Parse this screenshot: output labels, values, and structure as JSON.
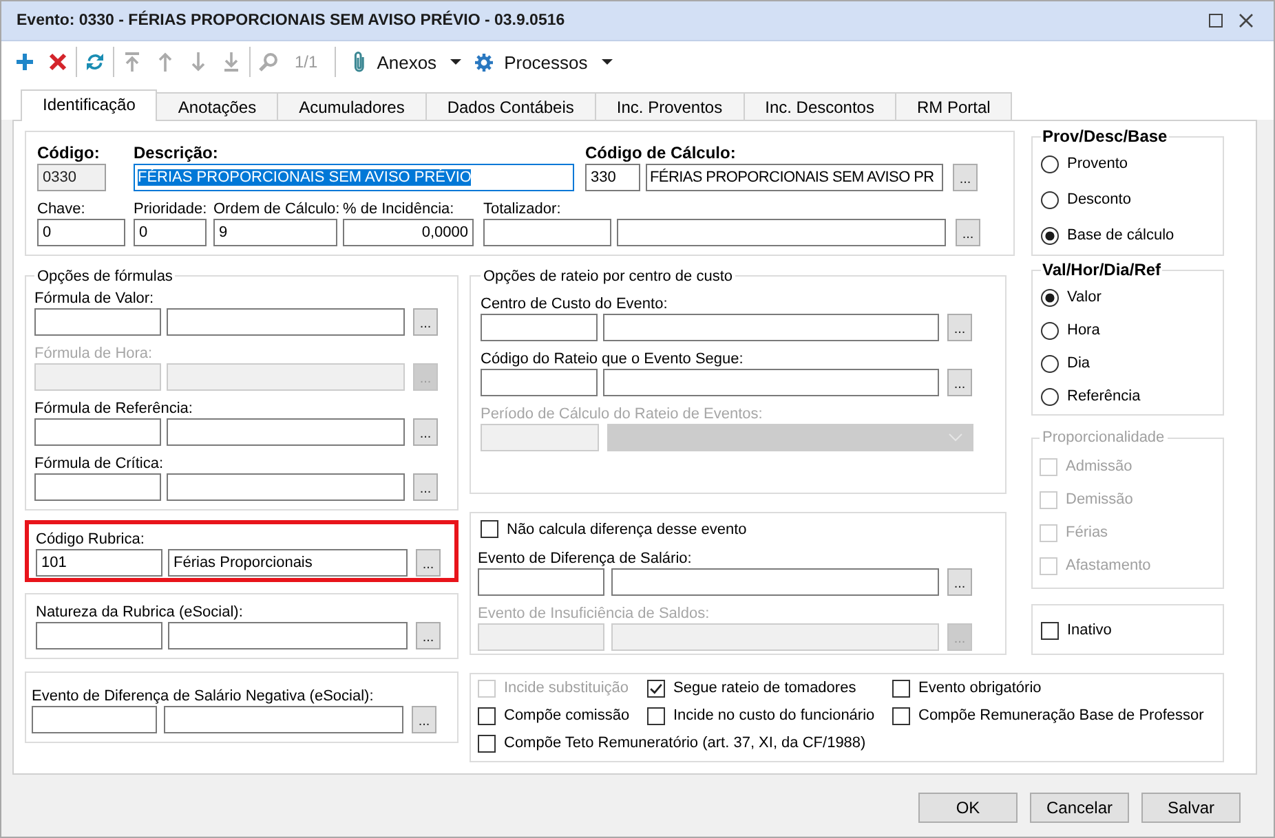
{
  "window": {
    "title": "Evento: 0330 - FÉRIAS PROPORCIONAIS SEM AVISO PRÉVIO - 03.9.0516"
  },
  "toolbar": {
    "button_groups": [
      [
        {
          "kind": "add",
          "disabled": false
        },
        {
          "kind": "delete",
          "disabled": false
        }
      ],
      [
        {
          "kind": "refresh",
          "disabled": false
        }
      ],
      [
        {
          "kind": "first",
          "disabled": true
        },
        {
          "kind": "previous",
          "disabled": true
        },
        {
          "kind": "next",
          "disabled": true
        },
        {
          "kind": "last",
          "disabled": true
        }
      ],
      [
        {
          "kind": "search",
          "disabled": true
        }
      ]
    ],
    "page_indicator": "1/1",
    "menus": [
      {
        "kind": "attachments",
        "label": "Anexos"
      },
      {
        "kind": "processes",
        "label": "Processos"
      }
    ]
  },
  "tabs": [
    {
      "label": "Identificação",
      "selected": true
    },
    {
      "label": "Anotações",
      "selected": false
    },
    {
      "label": "Acumuladores",
      "selected": false
    },
    {
      "label": "Dados Contábeis",
      "selected": false
    },
    {
      "label": "Inc. Proventos",
      "selected": false
    },
    {
      "label": "Inc. Descontos",
      "selected": false
    },
    {
      "label": "RM Portal",
      "selected": false
    }
  ],
  "header": {
    "fields": [
      {
        "kind": "text",
        "label": "Código:",
        "value": "0330",
        "read_only": true,
        "disabled": false
      },
      {
        "kind": "text",
        "label": "Descrição:",
        "value": "FÉRIAS PROPORCIONAIS SEM AVISO PRÉVIO",
        "disabled": false,
        "focused": true
      },
      {
        "kind": "lookup",
        "label": "Código de Cálculo:",
        "code": "330",
        "description": "FÉRIAS PROPORCIONAIS SEM AVISO PR",
        "disabled": false,
        "button": "..."
      },
      {
        "kind": "text",
        "label": "Chave:",
        "value": "0",
        "disabled": false
      },
      {
        "kind": "text",
        "label": "Prioridade:",
        "value": "0",
        "disabled": false
      },
      {
        "kind": "text",
        "label": "Ordem de Cálculo:",
        "value": "9",
        "disabled": false
      },
      {
        "kind": "text",
        "label": "% de Incidência:",
        "value": "0,0000",
        "disabled": false
      },
      {
        "kind": "lookup",
        "label": "Totalizador:",
        "disabled": false,
        "button": "..."
      }
    ]
  },
  "formulas": {
    "title": "Opções de fórmulas",
    "fields": [
      {
        "label": "Fórmula de Valor:",
        "disabled": false,
        "button": "..."
      },
      {
        "label": "Fórmula de Hora:",
        "disabled": true,
        "button": "..."
      },
      {
        "label": "Fórmula de Referência:",
        "disabled": false,
        "button": "..."
      },
      {
        "label": "Fórmula de Crítica:",
        "disabled": false,
        "button": "..."
      }
    ]
  },
  "codigo_rubrica": {
    "label": "Código Rubrica:",
    "code": "101",
    "description": "Férias Proporcionais",
    "disabled": false,
    "button": "...",
    "highlighted": true
  },
  "natureza_rubrica": {
    "label": "Natureza da Rubrica (eSocial):",
    "disabled": false,
    "button": "..."
  },
  "diferenca_negativa": {
    "label": "Evento de Diferença de Salário Negativa (eSocial):",
    "disabled": false,
    "button": "..."
  },
  "rateio": {
    "title": "Opções de rateio por centro de custo",
    "fields": [
      {
        "kind": "lookup",
        "label": "Centro de Custo do Evento:",
        "disabled": false,
        "button": "..."
      },
      {
        "kind": "lookup",
        "label": "Código do Rateio que o Evento Segue:",
        "disabled": false,
        "button": "..."
      },
      {
        "kind": "dropdown",
        "label": "Período de Cálculo do Rateio de Eventos:",
        "disabled": true
      }
    ]
  },
  "diferenca": {
    "checkbox": {
      "label": "Não calcula diferença desse evento",
      "checked": false,
      "disabled": false
    },
    "fields": [
      {
        "label": "Evento de Diferença de Salário:",
        "disabled": false,
        "button": "..."
      },
      {
        "label": "Evento de Insuficiência de Saldos:",
        "disabled": true,
        "button": "..."
      }
    ]
  },
  "prov_desc_base": {
    "title": "Prov/Desc/Base",
    "options": [
      {
        "label": "Provento",
        "selected": false
      },
      {
        "label": "Desconto",
        "selected": false
      },
      {
        "label": "Base de cálculo",
        "selected": true
      }
    ]
  },
  "val_hor_dia_ref": {
    "title": "Val/Hor/Dia/Ref",
    "options": [
      {
        "label": "Valor",
        "selected": true
      },
      {
        "label": "Hora",
        "selected": false
      },
      {
        "label": "Dia",
        "selected": false
      },
      {
        "label": "Referência",
        "selected": false
      }
    ]
  },
  "proporcionalidade": {
    "title": "Proporcionalidade",
    "disabled": true,
    "options": [
      {
        "label": "Admissão",
        "checked": false
      },
      {
        "label": "Demissão",
        "checked": false
      },
      {
        "label": "Férias",
        "checked": false
      },
      {
        "label": "Afastamento",
        "checked": false
      }
    ]
  },
  "inativo": {
    "label": "Inativo",
    "checked": false,
    "disabled": false
  },
  "flags": [
    {
      "label": "Incide substituição",
      "checked": false,
      "disabled": true
    },
    {
      "label": "Segue rateio de tomadores",
      "checked": true,
      "disabled": false
    },
    {
      "label": "Evento obrigatório",
      "checked": false,
      "disabled": false
    },
    {
      "label": "Compõe comissão",
      "checked": false,
      "disabled": false
    },
    {
      "label": "Incide no custo do funcionário",
      "checked": false,
      "disabled": false
    },
    {
      "label": "Compõe Remuneração Base de Professor",
      "checked": false,
      "disabled": false
    },
    {
      "label": "Compõe Teto Remuneratório (art. 37, XI, da CF/1988)",
      "checked": false,
      "disabled": false
    }
  ],
  "buttons": [
    {
      "label": "OK"
    },
    {
      "label": "Cancelar"
    },
    {
      "label": "Salvar"
    }
  ]
}
